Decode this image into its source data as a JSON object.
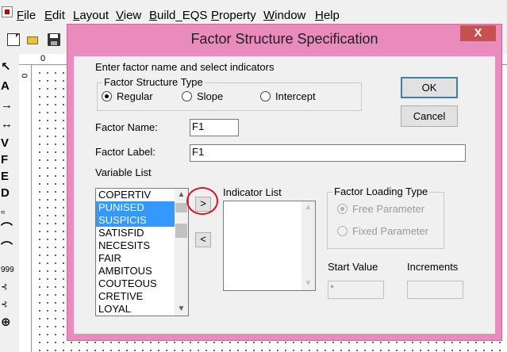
{
  "menu": [
    {
      "label": "File",
      "accel": "F",
      "rest": "ile"
    },
    {
      "label": "Edit",
      "accel": "E",
      "rest": "dit"
    },
    {
      "label": "Layout",
      "accel": "L",
      "rest": "ayout"
    },
    {
      "label": "View",
      "accel": "V",
      "rest": "iew"
    },
    {
      "label": "Build_EQS",
      "accel": "B",
      "rest": "uild_EQS"
    },
    {
      "label": "Property",
      "accel": "P",
      "rest": "roperty"
    },
    {
      "label": "Window",
      "accel": "W",
      "rest": "indow"
    },
    {
      "label": "Help",
      "accel": "H",
      "rest": "elp"
    }
  ],
  "tools": [
    "↖",
    "A",
    "→",
    "↔",
    "V",
    "F",
    "E",
    "D",
    "≈",
    "⌒",
    "⌒",
    "999",
    "⊰",
    "⊰",
    "⊕"
  ],
  "ruler": {
    "top_label": "0",
    "left_label": "0"
  },
  "dialog": {
    "title": "Factor Structure Specification",
    "close": "X",
    "accent_color": "#e98bbd",
    "instruction": "Enter factor name and select indicators",
    "structure_type": {
      "title": "Factor Structure Type",
      "options": [
        "Regular",
        "Slope",
        "Intercept"
      ],
      "selected": "Regular"
    },
    "ok": "OK",
    "cancel": "Cancel",
    "factor_name_label": "Factor Name:",
    "factor_name": "F1",
    "factor_label_label": "Factor Label:",
    "factor_label": "F1",
    "variable_list_label": "Variable List",
    "variables": [
      {
        "name": "COPERTIV",
        "selected": false
      },
      {
        "name": "PUNISED",
        "selected": true
      },
      {
        "name": "SUSPICIS",
        "selected": true
      },
      {
        "name": "SATISFID",
        "selected": false
      },
      {
        "name": "NECESITS",
        "selected": false
      },
      {
        "name": "FAIR",
        "selected": false
      },
      {
        "name": "AMBITOUS",
        "selected": false
      },
      {
        "name": "COUTEOUS",
        "selected": false
      },
      {
        "name": "CRETIVE",
        "selected": false
      },
      {
        "name": "LOYAL",
        "selected": false
      }
    ],
    "add_btn": ">",
    "remove_btn": "<",
    "indicator_list_label": "Indicator List",
    "loading_type": {
      "title": "Factor Loading Type",
      "options": [
        "Free Parameter",
        "Fixed Parameter"
      ],
      "selected": "Free Parameter"
    },
    "start_value_label": "Start Value",
    "start_value": "*",
    "increments_label": "Increments",
    "increments": "",
    "highlight_color": "#e01020"
  }
}
